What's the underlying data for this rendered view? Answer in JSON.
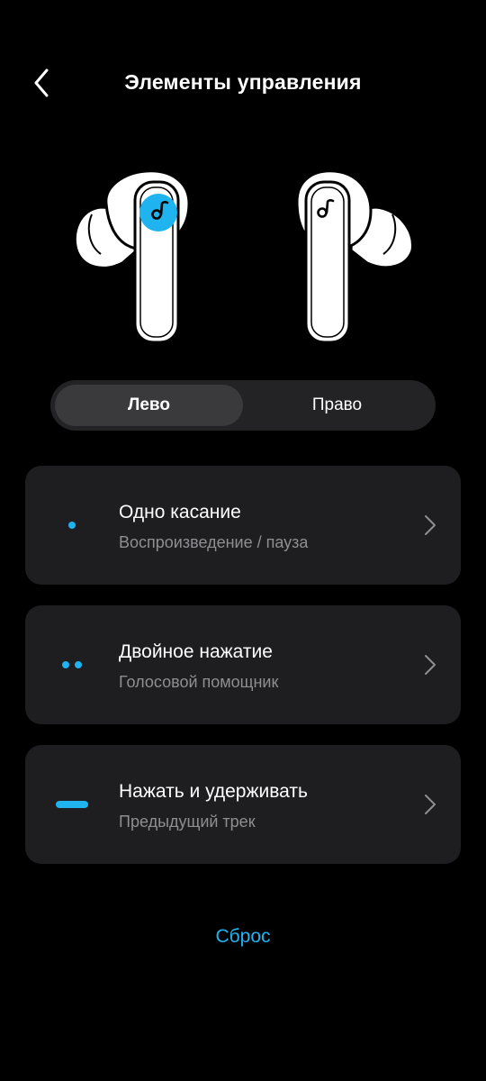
{
  "header": {
    "title": "Элементы управления"
  },
  "icons": {
    "back": "chevron-left-icon",
    "chevron": "chevron-right-icon",
    "brand": "soundcore-logo-icon"
  },
  "colors": {
    "accent": "#1fb4f0",
    "background": "#000000",
    "card": "#1e1e20",
    "segment_bg": "#232325",
    "segment_active": "#3a3a3c",
    "subtitle": "#8e8e93"
  },
  "segmented": {
    "left_label": "Лево",
    "right_label": "Право",
    "selected": "left"
  },
  "controls": [
    {
      "gesture": "single-dot",
      "title": "Одно касание",
      "action": "Воспроизведение / пауза"
    },
    {
      "gesture": "double-dot",
      "title": "Двойное нажатие",
      "action": "Голосовой помощник"
    },
    {
      "gesture": "long-bar",
      "title": "Нажать и удерживать",
      "action": "Предыдущий трек"
    }
  ],
  "footer": {
    "reset_label": "Сброс"
  }
}
